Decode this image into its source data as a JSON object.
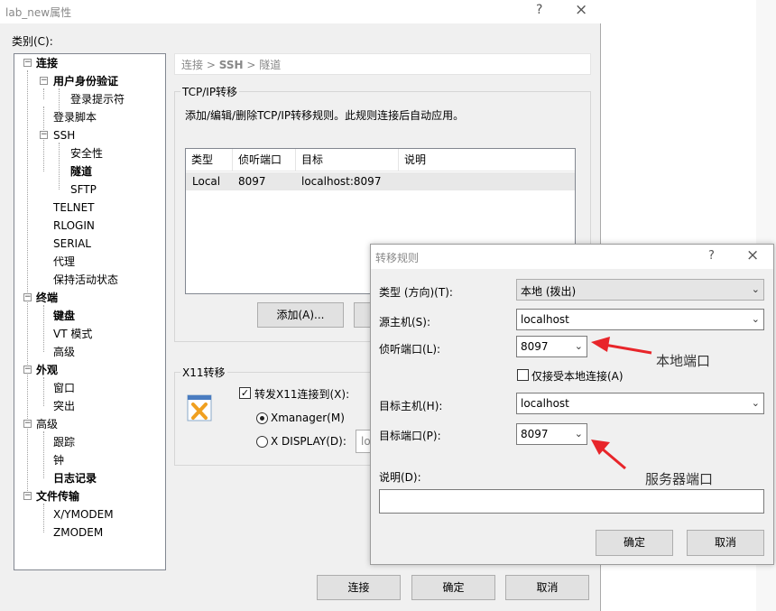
{
  "window": {
    "title": "lab_new属性",
    "help_glyph": "?",
    "close_glyph": "×"
  },
  "category_label": "类别(C):",
  "tree": {
    "expand_glyph": "−",
    "items": [
      {
        "label": "连接"
      },
      {
        "label": "用户身份验证"
      },
      {
        "label": "登录提示符"
      },
      {
        "label": "登录脚本"
      },
      {
        "label": "SSH"
      },
      {
        "label": "安全性"
      },
      {
        "label": "隧道"
      },
      {
        "label": "SFTP"
      },
      {
        "label": "TELNET"
      },
      {
        "label": "RLOGIN"
      },
      {
        "label": "SERIAL"
      },
      {
        "label": "代理"
      },
      {
        "label": "保持活动状态"
      },
      {
        "label": "终端"
      },
      {
        "label": "键盘"
      },
      {
        "label": "VT 模式"
      },
      {
        "label": "高级"
      },
      {
        "label": "外观"
      },
      {
        "label": "窗口"
      },
      {
        "label": "突出"
      },
      {
        "label": "高级"
      },
      {
        "label": "跟踪"
      },
      {
        "label": "钟"
      },
      {
        "label": "日志记录"
      },
      {
        "label": "文件传输"
      },
      {
        "label": "X/YMODEM"
      },
      {
        "label": "ZMODEM"
      }
    ]
  },
  "breadcrumb": {
    "part1": "连接",
    "sep1": ">",
    "part2": "SSH",
    "sep2": ">",
    "part3": "隧道"
  },
  "tcpip": {
    "title": "TCP/IP转移",
    "description": "添加/编辑/删除TCP/IP转移规则。此规则连接后自动应用。",
    "columns": [
      "类型",
      "侦听端口",
      "目标",
      "说明"
    ],
    "rows": [
      {
        "type": "Local",
        "port": "8097",
        "target": "localhost:8097",
        "note": ""
      }
    ],
    "add_button": "添加(A)..."
  },
  "x11": {
    "title": "X11转移",
    "forward_label": "转发X11连接到(X):",
    "forward_checked": true,
    "check_glyph": "✓",
    "xmanager_label": "Xmanager(M)",
    "xdisplay_label": "X DISPLAY(D):",
    "xdisplay_value_partial": "lo"
  },
  "footer": {
    "connect": "连接",
    "ok": "确定",
    "cancel": "取消"
  },
  "rule_dialog": {
    "title": "转移规则",
    "help_glyph": "?",
    "close_glyph": "×",
    "arrow_glyph": "⌄",
    "type_label": "类型 (方向)(T):",
    "type_value": "本地 (拨出)",
    "source_host_label": "源主机(S):",
    "source_host_value": "localhost",
    "listen_port_label": "侦听端口(L):",
    "listen_port_value": "8097",
    "local_only_label": "仅接受本地连接(A)",
    "local_only_checked": false,
    "dest_host_label": "目标主机(H):",
    "dest_host_value": "localhost",
    "dest_port_label": "目标端口(P):",
    "dest_port_value": "8097",
    "note_label": "说明(D):",
    "note_value": "",
    "ok": "确定",
    "cancel": "取消"
  },
  "annotations": {
    "local_port": "本地端口",
    "server_port": "服务器端口",
    "arrow_color": "#e8252a"
  }
}
